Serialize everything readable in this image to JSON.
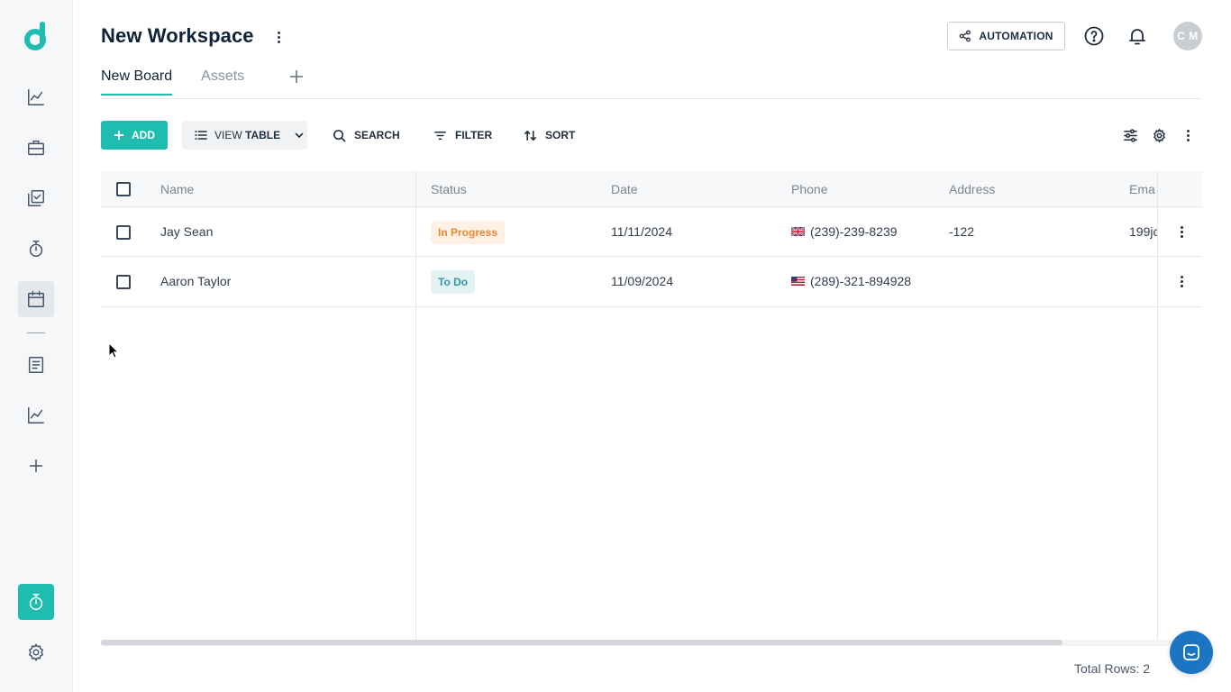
{
  "workspace": {
    "title": "New Workspace"
  },
  "header": {
    "automation_label": "AUTOMATION",
    "avatar_initials": "C M"
  },
  "tabs": [
    {
      "label": "New Board",
      "active": true
    },
    {
      "label": "Assets",
      "active": false
    }
  ],
  "toolbar": {
    "add_label": "ADD",
    "view_prefix": "VIEW",
    "view_value": "TABLE",
    "search_label": "SEARCH",
    "filter_label": "FILTER",
    "sort_label": "SORT"
  },
  "table": {
    "columns": [
      "Name",
      "Status",
      "Date",
      "Phone",
      "Address",
      "Ema"
    ],
    "rows": [
      {
        "name": "Jay Sean",
        "status": "In Progress",
        "date": "11/11/2024",
        "phone": "(239)-239-8239",
        "address": "-122",
        "email": "199jc"
      },
      {
        "name": "Aaron Taylor",
        "status": "To Do",
        "date": "11/09/2024",
        "phone": "(289)-321-894928",
        "address": "",
        "email": ""
      }
    ]
  },
  "footer": {
    "total_rows": "Total Rows: 2"
  },
  "colors": {
    "accent": "#1fbdb0",
    "in_progress": "#e58a3a",
    "to_do": "#3397a6",
    "chat": "#1a75c2"
  },
  "icons": {
    "sidebar": [
      "line-chart-icon",
      "briefcase-icon",
      "checklist-icon",
      "stopwatch-icon",
      "calendar-icon",
      "document-icon",
      "line-chart-icon",
      "plus-icon",
      "stopwatch-icon",
      "settings-icon"
    ],
    "header": [
      "share-icon",
      "help-icon",
      "bell-icon"
    ],
    "toolbar": [
      "plus-icon",
      "list-icon",
      "chevron-down-icon",
      "search-icon",
      "filter-icon",
      "sort-icon",
      "sliders-icon",
      "gear-icon",
      "more-vertical-icon"
    ]
  }
}
